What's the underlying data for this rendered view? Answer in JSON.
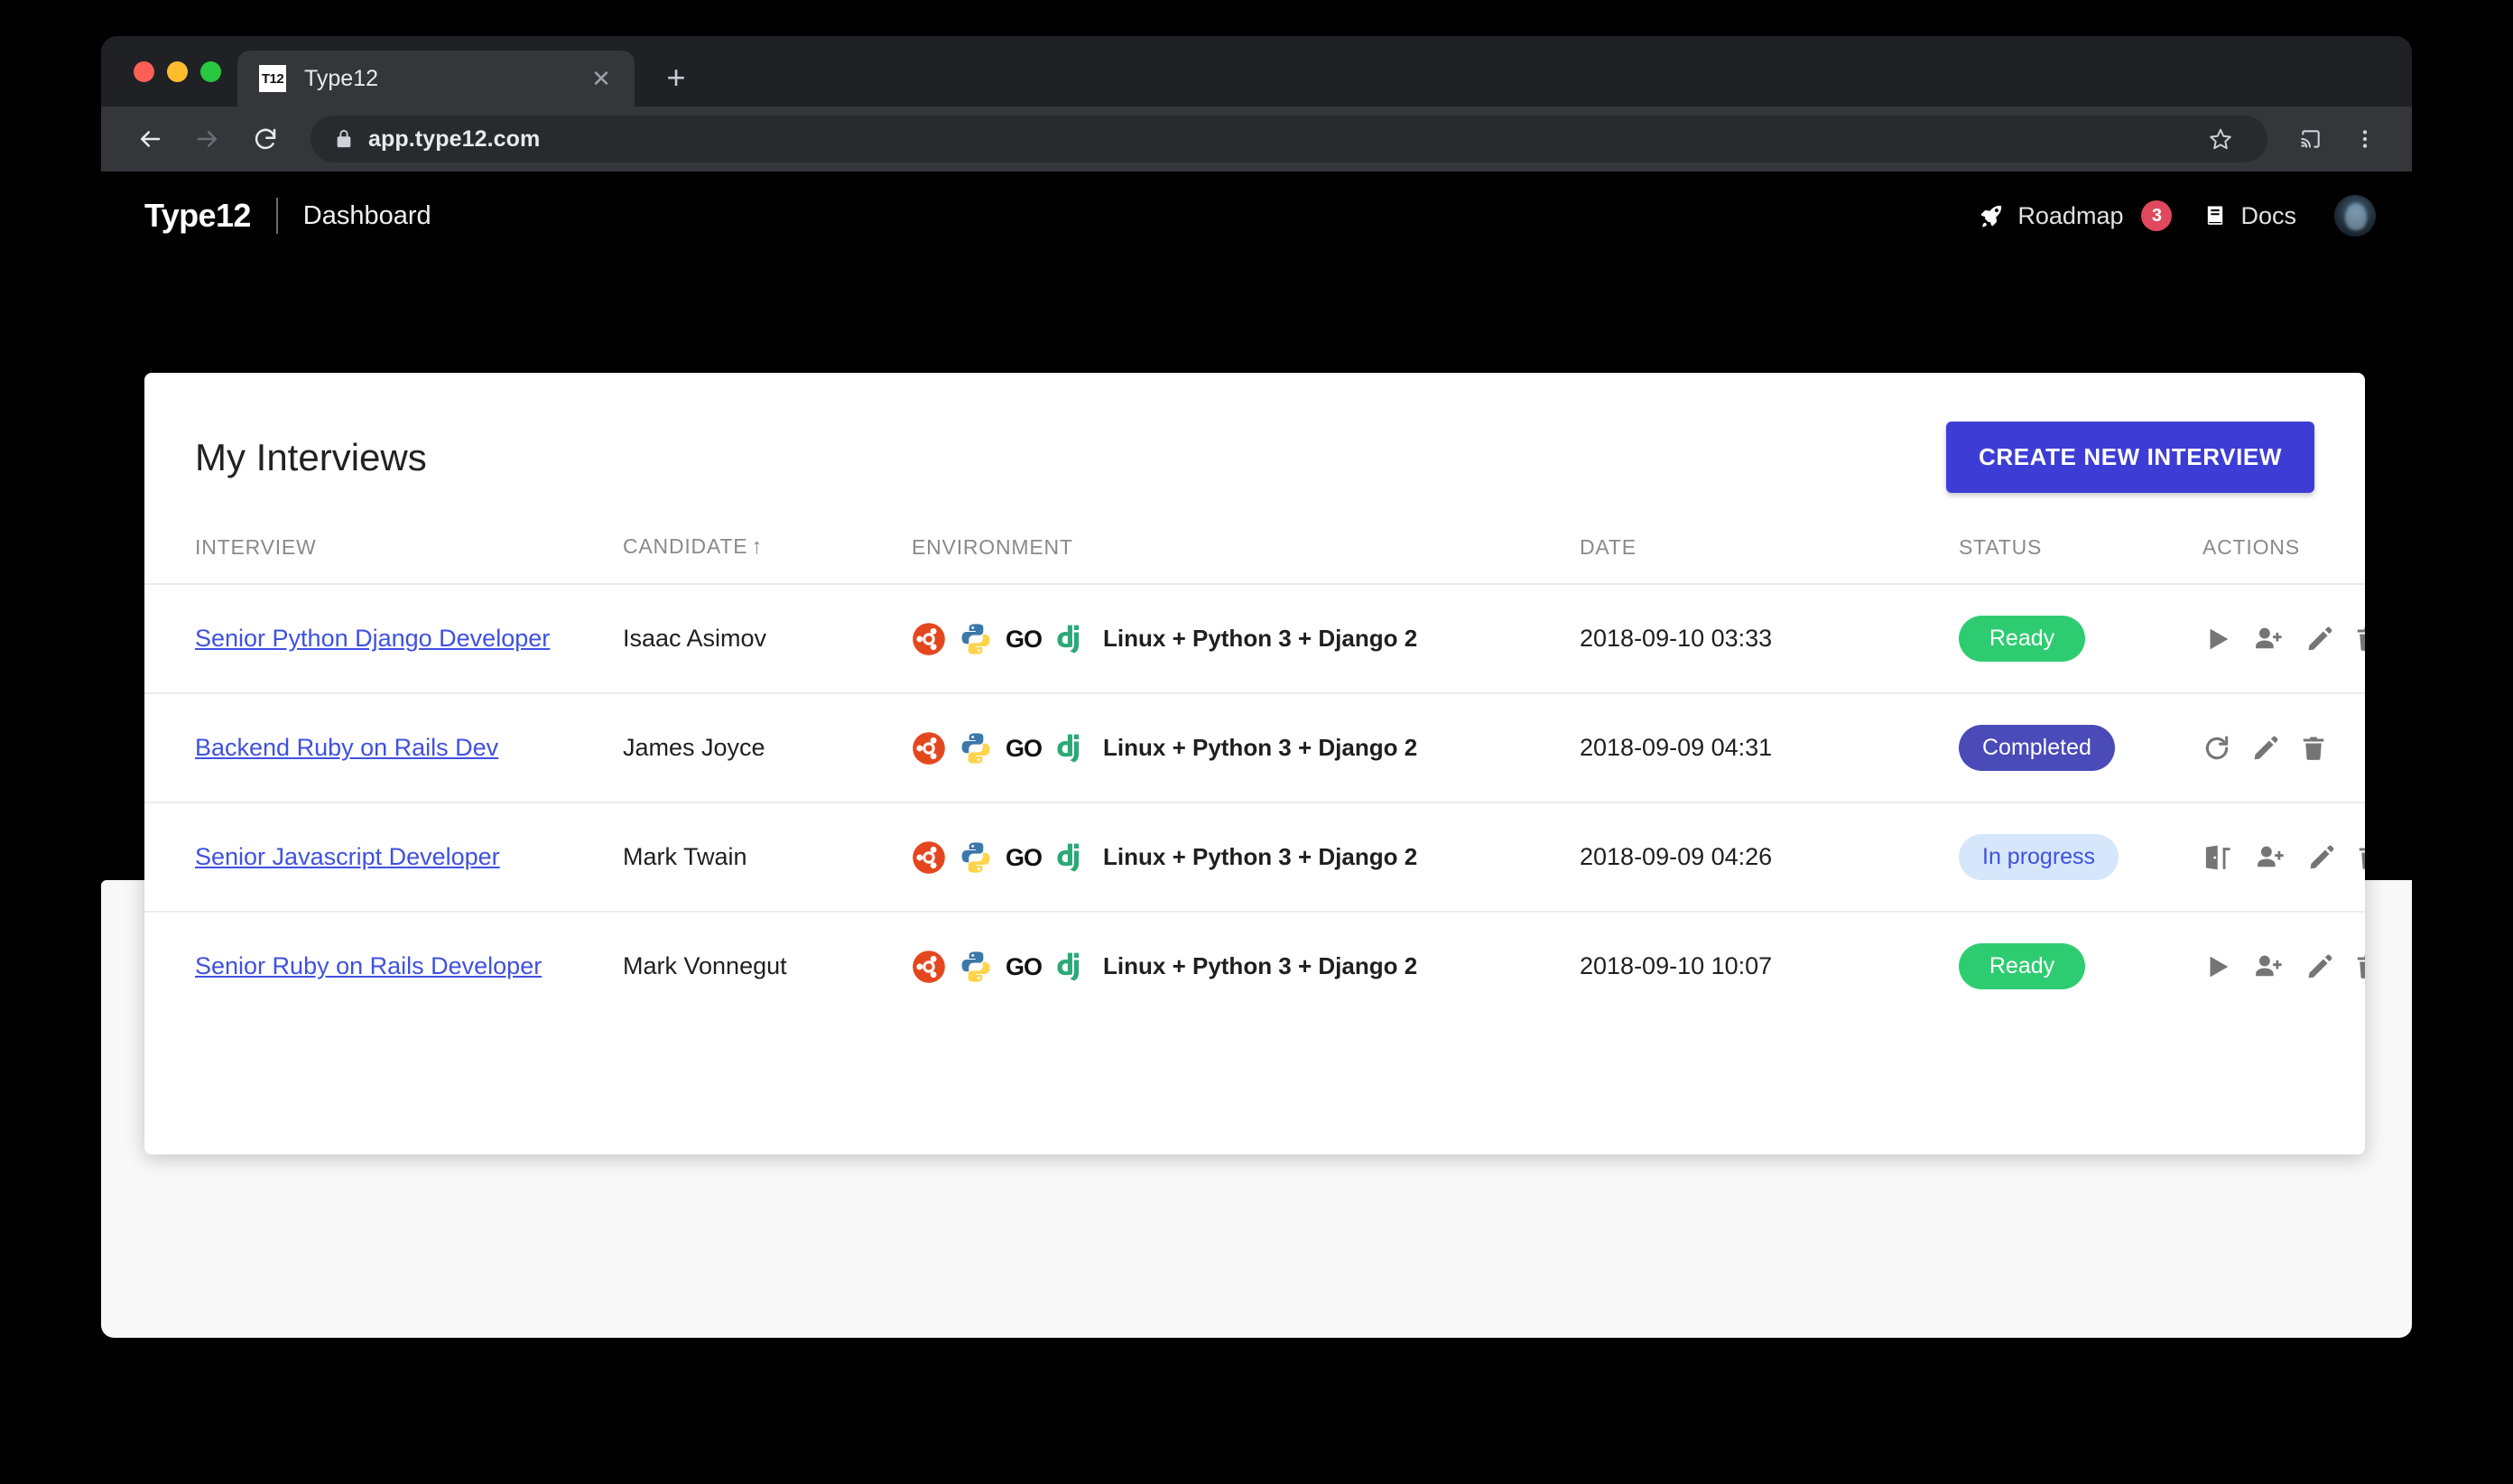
{
  "browser": {
    "tab": {
      "title": "Type12",
      "favicon_label": "T12",
      "close_icon": "close-icon"
    },
    "new_tab_label": "+",
    "url": "app.type12.com",
    "icons": {
      "back": "back-arrow-icon",
      "forward": "forward-arrow-icon",
      "reload": "reload-icon",
      "lock": "lock-icon",
      "star": "star-icon",
      "cast": "cast-icon",
      "menu": "kebab-menu-icon"
    }
  },
  "app_header": {
    "brand": "Type12",
    "page_name": "Dashboard",
    "roadmap": {
      "label": "Roadmap",
      "badge": "3",
      "icon": "rocket-icon"
    },
    "docs": {
      "label": "Docs",
      "icon": "book-icon"
    },
    "avatar": "user-avatar"
  },
  "card": {
    "title": "My Interviews",
    "create_button": "CREATE NEW INTERVIEW"
  },
  "table": {
    "columns": [
      {
        "label": "INTERVIEW",
        "sorted": false
      },
      {
        "label": "CANDIDATE",
        "sorted": true,
        "sort_arrow": "↑"
      },
      {
        "label": "ENVIRONMENT",
        "sorted": false
      },
      {
        "label": "DATE",
        "sorted": false
      },
      {
        "label": "STATUS",
        "sorted": false
      },
      {
        "label": "ACTIONS",
        "sorted": false
      }
    ],
    "rows": [
      {
        "interview": "Senior Python Django Developer",
        "candidate": "Isaac Asimov",
        "environment": "Linux + Python 3 + Django 2",
        "env_icons": [
          "ubuntu-icon",
          "python-icon",
          "go-icon",
          "django-icon"
        ],
        "date": "2018-09-10 03:33",
        "status": "Ready",
        "status_kind": "ready",
        "actions": [
          "play-icon",
          "person-add-icon",
          "pencil-icon",
          "trash-icon"
        ]
      },
      {
        "interview": "Backend Ruby on Rails Dev",
        "candidate": "James Joyce",
        "environment": "Linux + Python 3 + Django 2",
        "env_icons": [
          "ubuntu-icon",
          "python-icon",
          "go-icon",
          "django-icon"
        ],
        "date": "2018-09-09 04:31",
        "status": "Completed",
        "status_kind": "completed",
        "actions": [
          "restart-icon",
          "pencil-icon",
          "trash-icon"
        ]
      },
      {
        "interview": "Senior Javascript Developer",
        "candidate": "Mark Twain",
        "environment": "Linux + Python 3 + Django 2",
        "env_icons": [
          "ubuntu-icon",
          "python-icon",
          "go-icon",
          "django-icon"
        ],
        "date": "2018-09-09 04:26",
        "status": "In progress",
        "status_kind": "inprogress",
        "actions": [
          "join-door-icon",
          "person-add-icon",
          "pencil-icon",
          "trash-icon"
        ]
      },
      {
        "interview": "Senior Ruby on Rails Developer",
        "candidate": "Mark Vonnegut",
        "environment": "Linux + Python 3 + Django 2",
        "env_icons": [
          "ubuntu-icon",
          "python-icon",
          "go-icon",
          "django-icon"
        ],
        "date": "2018-09-10 10:07",
        "status": "Ready",
        "status_kind": "ready",
        "actions": [
          "play-icon",
          "person-add-icon",
          "pencil-icon",
          "trash-icon"
        ]
      }
    ]
  },
  "colors": {
    "accent": "#3d3dd6",
    "link": "#3f51e0",
    "ready": "#2ecc71",
    "completed": "#4a4ab8",
    "inprogress_bg": "#d6e7fb",
    "badge_red": "#e0485d",
    "page_bg": "#000000"
  }
}
